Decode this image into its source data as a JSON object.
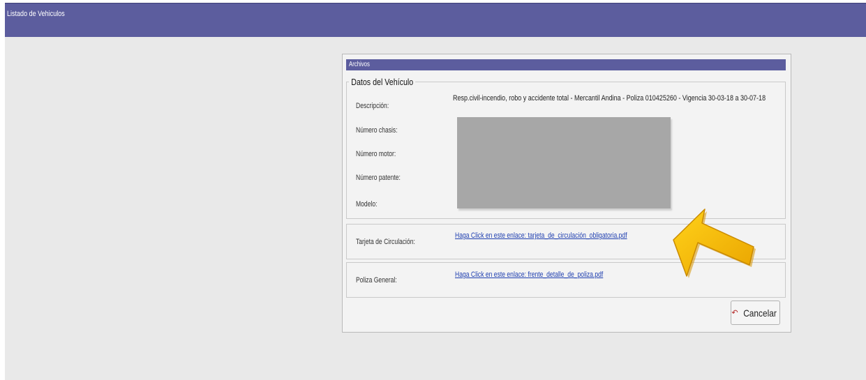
{
  "header": {
    "title": "Listado de Vehiculos"
  },
  "panel": {
    "title": "Archivos",
    "section_title": "Datos del Vehículo",
    "fields": {
      "descripcion_label": "Descripción:",
      "descripcion_value": "Resp.civil-incendio, robo y accidente total - Mercantil Andina - Poliza 010425260 - Vigencia 30-03-18 a 30-07-18",
      "chasis_label": "Número chasis:",
      "motor_label": "Número motor:",
      "patente_label": "Número patente:",
      "modelo_label": "Modelo:"
    },
    "tarjeta": {
      "label": "Tarjeta de Circulación:",
      "link": "Haga Click en este enlace: tarjeta_de_circulación_obligatoria.pdf"
    },
    "poliza": {
      "label": "Poliza General:",
      "link": "Haga Click en este enlace: frente_detalle_de_poliza.pdf"
    },
    "cancel_label": "Cancelar",
    "cancel_icon": "undo-icon"
  },
  "colors": {
    "header_bar": "#5c5d9e",
    "background": "#e9e9e9",
    "link": "#1f3fb0",
    "arrow": "#f5b800"
  }
}
